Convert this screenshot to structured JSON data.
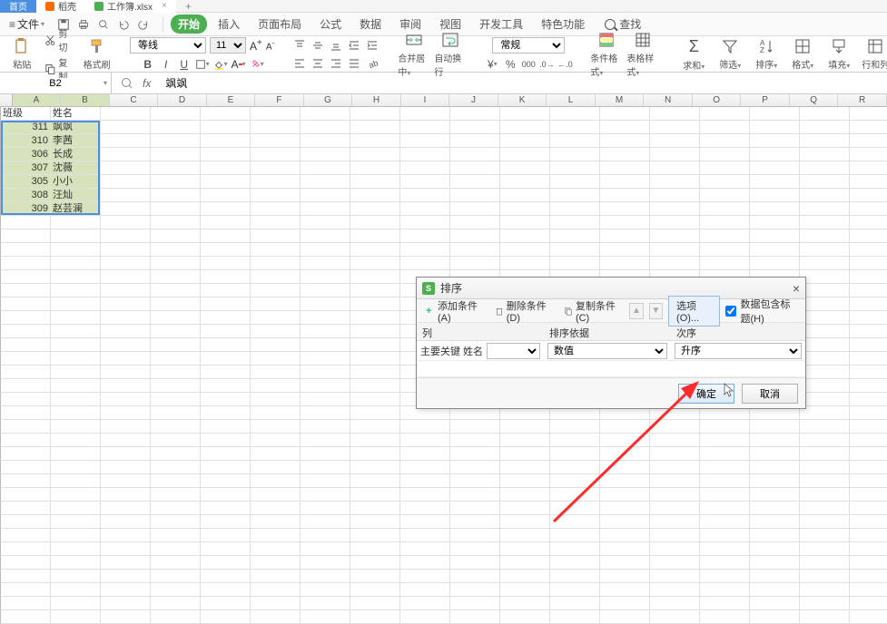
{
  "tabs": {
    "home": "首页",
    "dk": "稻壳",
    "sheet": "工作簿.xlsx"
  },
  "menu": {
    "file": "文件",
    "start": "开始",
    "insert": "插入",
    "page_layout": "页面布局",
    "formula": "公式",
    "data": "数据",
    "review": "审阅",
    "view": "视图",
    "developer": "开发工具",
    "special": "特色功能",
    "search": "查找"
  },
  "ribbon": {
    "paste": "粘贴",
    "cut": "剪切",
    "copy": "复制",
    "format_painter": "格式刷",
    "font": "等线",
    "font_size": "11",
    "merge": "合并居中",
    "wrap": "自动换行",
    "number_format": "常规",
    "cond_format": "条件格式",
    "table_style": "表格样式",
    "sum": "求和",
    "filter": "筛选",
    "sort": "排序",
    "format": "格式",
    "fill": "填充",
    "row_col": "行和列"
  },
  "namebox": "B2",
  "formula": "飒飒",
  "columns": [
    "A",
    "B",
    "C",
    "D",
    "E",
    "F",
    "G",
    "H",
    "I",
    "J",
    "K",
    "L",
    "M",
    "N",
    "O",
    "P",
    "Q",
    "R"
  ],
  "data_header": {
    "a": "班级",
    "b": "姓名"
  },
  "rows": [
    {
      "a": "311",
      "b": "飒飒"
    },
    {
      "a": "310",
      "b": "李茜"
    },
    {
      "a": "306",
      "b": "长成"
    },
    {
      "a": "307",
      "b": "沈薇"
    },
    {
      "a": "305",
      "b": "小小"
    },
    {
      "a": "308",
      "b": "汪灿"
    },
    {
      "a": "309",
      "b": "赵芸澜"
    }
  ],
  "dialog": {
    "title": "排序",
    "add": "添加条件(A)",
    "delete": "删除条件(D)",
    "copy": "复制条件(C)",
    "options": "选项(O)...",
    "headers_chk": "数据包含标题(H)",
    "col_header": "列",
    "sort_by_header": "排序依据",
    "order_header": "次序",
    "primary_label": "主要关键 姓名",
    "sort_by_value": "数值",
    "order_value": "升序",
    "ok": "确定",
    "cancel": "取消"
  }
}
